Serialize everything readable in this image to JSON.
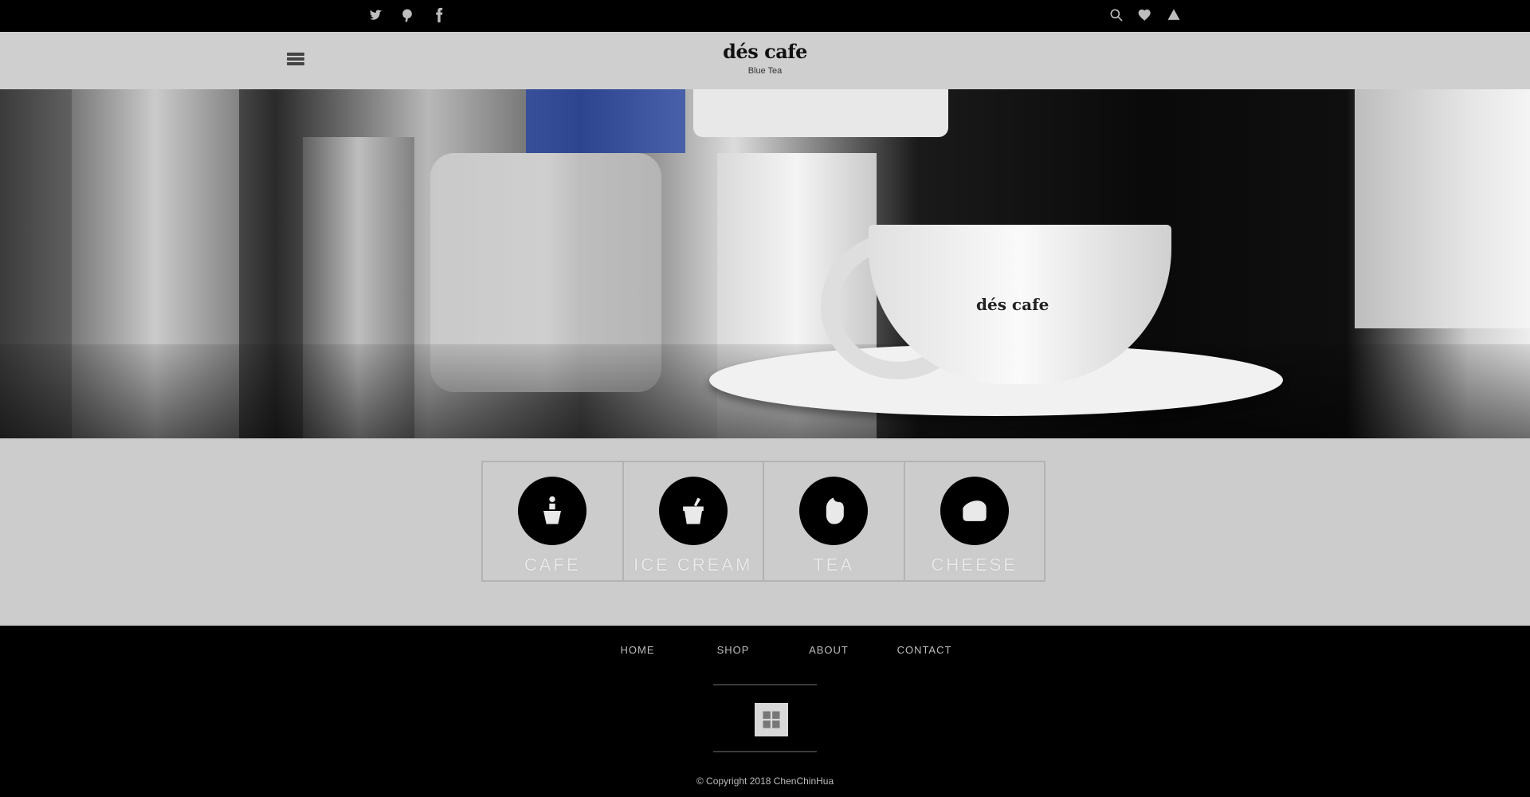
{
  "topbar": {
    "social_icons": [
      "twitter-icon",
      "pinterest-icon",
      "facebook-icon"
    ],
    "util_icons": [
      "search-icon",
      "heart-icon",
      "user-icon"
    ]
  },
  "header": {
    "logo_name": "dés cafe",
    "logo_tagline": "Blue Tea"
  },
  "hero": {
    "cup_logo": "dés cafe"
  },
  "categories": [
    {
      "label": "CAFE",
      "icon": "cafe-icon"
    },
    {
      "label": "ICE CREAM",
      "icon": "ice-cream-icon"
    },
    {
      "label": "TEA",
      "icon": "tea-icon"
    },
    {
      "label": "CHEESE",
      "icon": "cheese-icon"
    }
  ],
  "footer": {
    "nav": [
      "HOME",
      "SHOP",
      "ABOUT",
      "CONTACT"
    ],
    "badge_icon": "store-badge-icon",
    "copyright": "© Copyright 2018 ChenChinHua"
  }
}
